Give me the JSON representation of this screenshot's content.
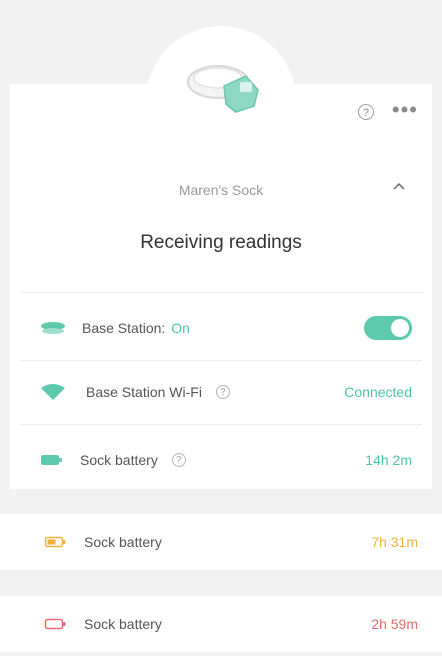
{
  "device": {
    "name": "Maren's Sock",
    "status": "Receiving readings",
    "help_glyph": "?",
    "more_glyph": "•••"
  },
  "rows": {
    "base_station": {
      "label": "Base Station:",
      "state": "On",
      "toggle_on": true,
      "icon": "base-station-icon"
    },
    "wifi": {
      "label": "Base Station Wi-Fi",
      "value": "Connected",
      "info_glyph": "?",
      "icon": "wifi-icon"
    },
    "battery_main": {
      "label": "Sock battery",
      "value": "14h 2m",
      "info_glyph": "?",
      "icon": "battery-full-icon"
    }
  },
  "battery_examples": [
    {
      "label": "Sock battery",
      "value": "7h 31m",
      "color": "#f0b23a",
      "icon": "battery-medium-icon"
    },
    {
      "label": "Sock battery",
      "value": "2h 59m",
      "color": "#e86a6a",
      "icon": "battery-low-icon"
    }
  ],
  "colors": {
    "accent": "#4cc6a8",
    "battery_full": "#5cc9ad",
    "battery_medium": "#f0b23a",
    "battery_low": "#e86a6a"
  }
}
